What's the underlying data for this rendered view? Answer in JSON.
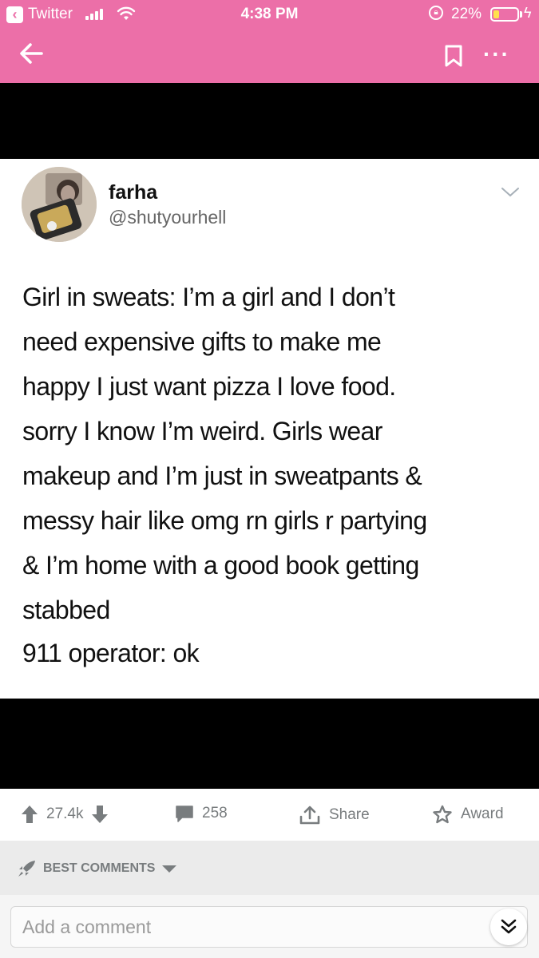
{
  "status_bar": {
    "back_app_label": "Twitter",
    "time": "4:38 PM",
    "battery_percent": "22%",
    "battery_level": 0.22
  },
  "colors": {
    "header_bg": "#ec6fa8",
    "battery_fill": "#ffe14d",
    "action_gray": "#787c7e"
  },
  "nav": {
    "icons": [
      "arrow-left-icon",
      "bookmark-icon",
      "more-icon"
    ]
  },
  "tweet": {
    "name": "farha",
    "handle": "@shutyourhell",
    "text": "Girl in sweats: I’m a girl and I don’t\nneed expensive gifts to make me\nhappy I just want pizza I love food.\nsorry I know I’m weird. Girls wear\nmakeup and I’m just in sweatpants &\nmessy hair like omg rn girls r partying\n& I’m home with a good book getting\nstabbed",
    "reply": "911 operator: ok"
  },
  "actions": {
    "score": "27.4k",
    "comments": "258",
    "share": "Share",
    "award": "Award"
  },
  "comments": {
    "sort_label": "BEST COMMENTS",
    "placeholder": "Add a comment"
  }
}
